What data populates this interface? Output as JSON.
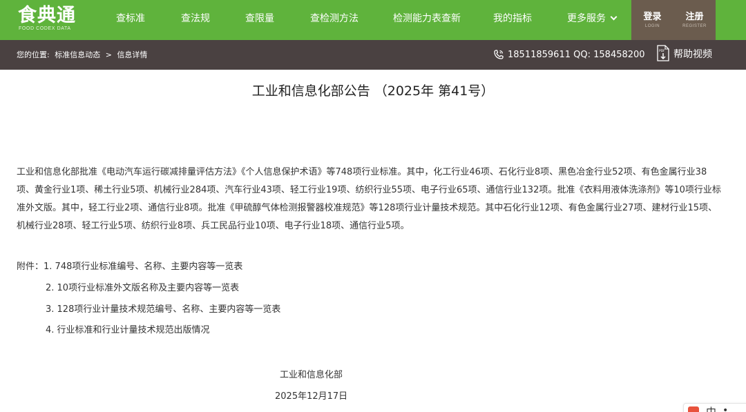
{
  "header": {
    "logo_text": "食典通",
    "logo_sub": "FOOD CODEX DATA",
    "nav": [
      {
        "label": "查标准"
      },
      {
        "label": "查法规"
      },
      {
        "label": "查限量"
      },
      {
        "label": "查检测方法"
      },
      {
        "label": "检测能力表查新"
      },
      {
        "label": "我的指标"
      },
      {
        "label": "更多服务"
      }
    ],
    "login": {
      "label": "登录",
      "sub": "LOGIN"
    },
    "register": {
      "label": "注册",
      "sub": "REGISTER"
    }
  },
  "breadcrumb": {
    "prefix": "您的位置:",
    "section": "标准信息动态",
    "separator": ">",
    "current": "信息详情"
  },
  "contact": {
    "phone": "18511859611",
    "qq_label": "QQ:",
    "qq": "158458200",
    "help_label": "帮助视频",
    "pdf_icon_text": "PDF"
  },
  "article": {
    "title": "工业和信息化部公告 （2025年 第41号）",
    "body": "工业和信息化部批准《电动汽车运行碳减排量评估方法》《个人信息保护术语》等748项行业标准。其中，化工行业46项、石化行业8项、黑色冶金行业52项、有色金属行业38项、黄金行业1项、稀土行业5项、机械行业284项、汽车行业43项、轻工行业19项、纺织行业55项、电子行业65项、通信行业132项。批准《衣料用液体洗涤剂》等10项行业标准外文版。其中，轻工行业2项、通信行业8项。批准《甲硫醇气体检测报警器校准规范》等128项行业计量技术规范。其中石化行业12项、有色金属行业27项、建材行业15项、机械行业28项、轻工行业5项、纺织行业8项、兵工民品行业10项、电子行业18项、通信行业5项。",
    "attachments_label": "附件：",
    "attachments": [
      "1. 748项行业标准编号、名称、主要内容等一览表",
      "2. 10项行业标准外文版名称及主要内容等一览表",
      "3. 128项行业计量技术规范编号、名称、主要内容等一览表",
      "4. 行业标准和行业计量技术规范出版情况"
    ],
    "signature": "工业和信息化部",
    "date": "2025年12月17日"
  },
  "widget": {
    "char": "中"
  },
  "colors": {
    "nav_green": "#5fb33c",
    "auth_brown": "#6b5c4e",
    "crumb_bar": "#4a4141"
  }
}
